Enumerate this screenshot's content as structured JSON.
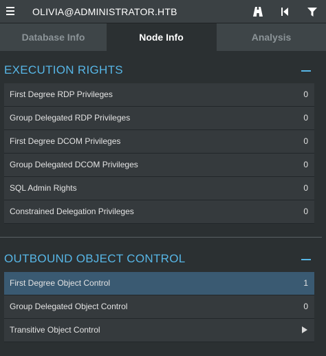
{
  "topbar": {
    "title": "OLIVIA@ADMINISTRATOR.HTB",
    "icons": [
      "menu-icon",
      "pathfinding-icon",
      "back-icon",
      "filter-icon"
    ]
  },
  "tabs": [
    {
      "label": "Database Info",
      "active": false
    },
    {
      "label": "Node Info",
      "active": true
    },
    {
      "label": "Analysis",
      "active": false
    }
  ],
  "execution_rights": {
    "title": "EXECUTION RIGHTS",
    "rows": [
      {
        "label": "First Degree RDP Privileges",
        "value": "0"
      },
      {
        "label": "Group Delegated RDP Privileges",
        "value": "0"
      },
      {
        "label": "First Degree DCOM Privileges",
        "value": "0"
      },
      {
        "label": "Group Delegated DCOM Privileges",
        "value": "0"
      },
      {
        "label": "SQL Admin Rights",
        "value": "0"
      },
      {
        "label": "Constrained Delegation Privileges",
        "value": "0"
      }
    ]
  },
  "outbound_object_control": {
    "title": "OUTBOUND OBJECT CONTROL",
    "rows": [
      {
        "label": "First Degree Object Control",
        "value": "1",
        "highlighted": true
      },
      {
        "label": "Group Delegated Object Control",
        "value": "0"
      },
      {
        "label": "Transitive Object Control",
        "icon": "play-arrow-icon"
      }
    ]
  },
  "colors": {
    "accent": "#57b6e6",
    "highlight_row": "#3a5a72",
    "background": "#2b3032"
  }
}
